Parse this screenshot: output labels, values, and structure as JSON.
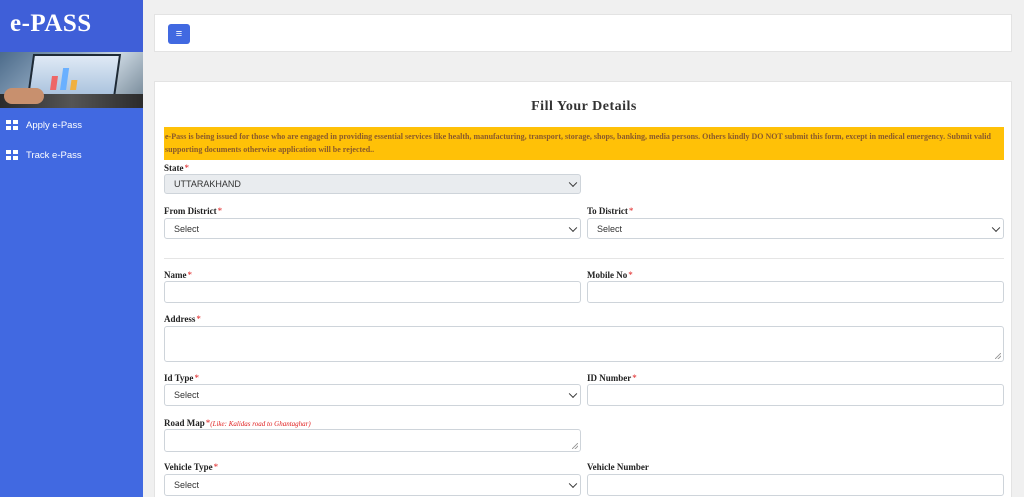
{
  "app": {
    "brand": "e-PASS"
  },
  "sidebar": {
    "items": [
      {
        "label": "Apply e-Pass",
        "icon": "grid-icon"
      },
      {
        "label": "Track e-Pass",
        "icon": "grid-icon"
      }
    ]
  },
  "topbar": {
    "menu_icon": "hamburger-icon",
    "menu_glyph": "≡"
  },
  "form": {
    "title": "Fill Your Details",
    "notice": "e-Pass is being issued for those who are engaged in providing essential services like health, manufacturing, transport, storage, shops, banking, media persons. Others kindly DO NOT submit this form, except in medical emergency. Submit valid supporting documents otherwise application will be rejected..",
    "required_mark": "*",
    "state": {
      "label": "State",
      "value": "UTTARAKHAND"
    },
    "from_district": {
      "label": "From District",
      "value": "Select"
    },
    "to_district": {
      "label": "To District",
      "value": "Select"
    },
    "name": {
      "label": "Name",
      "value": ""
    },
    "mobile": {
      "label": "Mobile No",
      "value": ""
    },
    "address": {
      "label": "Address",
      "value": ""
    },
    "id_type": {
      "label": "Id Type",
      "value": "Select"
    },
    "id_number": {
      "label": "ID Number",
      "value": ""
    },
    "road_map": {
      "label": "Road Map",
      "hint": "(Like: Kalidas road to Ghantaghar)",
      "value": ""
    },
    "vehicle_type": {
      "label": "Vehicle Type",
      "value": "Select"
    },
    "vehicle_number": {
      "label": "Vehicle Number",
      "value": ""
    }
  },
  "colors": {
    "sidebar": "#4169e1",
    "notice": "#ffc107",
    "required": "#e02020"
  }
}
